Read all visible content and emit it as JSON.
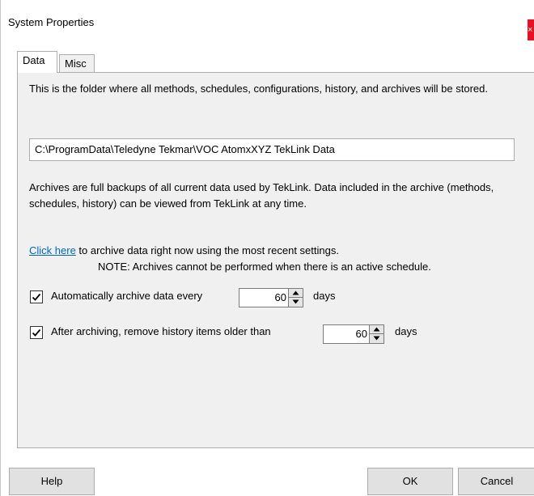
{
  "window": {
    "title": "System Properties",
    "close_glyph": "×",
    "close_color": "#e81123"
  },
  "tabs": [
    {
      "label": "Data",
      "active": true
    },
    {
      "label": "Misc",
      "active": false
    }
  ],
  "data_tab": {
    "folder_description": "This is the folder where all methods, schedules, configurations, history, and archives will be stored.",
    "folder_path": "C:\\ProgramData\\Teledyne Tekmar\\VOC AtomxXYZ TekLink Data",
    "archive_description": "Archives are full backups of all current data used by TekLink.  Data included in the archive (methods, schedules, history) can be viewed from TekLink at any time.",
    "archive_now_link": "Click here",
    "archive_now_text": " to archive data right now using the most recent settings.",
    "archive_note": "NOTE: Archives cannot be performed when there is an active schedule.",
    "auto_archive": {
      "checked": true,
      "label": "Automatically archive data every",
      "value": "60",
      "unit": "days"
    },
    "remove_history": {
      "checked": true,
      "label": "After archiving, remove history items older than",
      "value": "60",
      "unit": "days"
    }
  },
  "buttons": {
    "help": "Help",
    "ok": "OK",
    "cancel": "Cancel"
  },
  "icons": {
    "check": "checkmark-icon",
    "spin_up": "caret-up-icon",
    "spin_down": "caret-down-icon"
  },
  "colors": {
    "link": "#0066cc",
    "panel_bg": "#f0f0f0",
    "button_bg": "#e1e1e1"
  }
}
